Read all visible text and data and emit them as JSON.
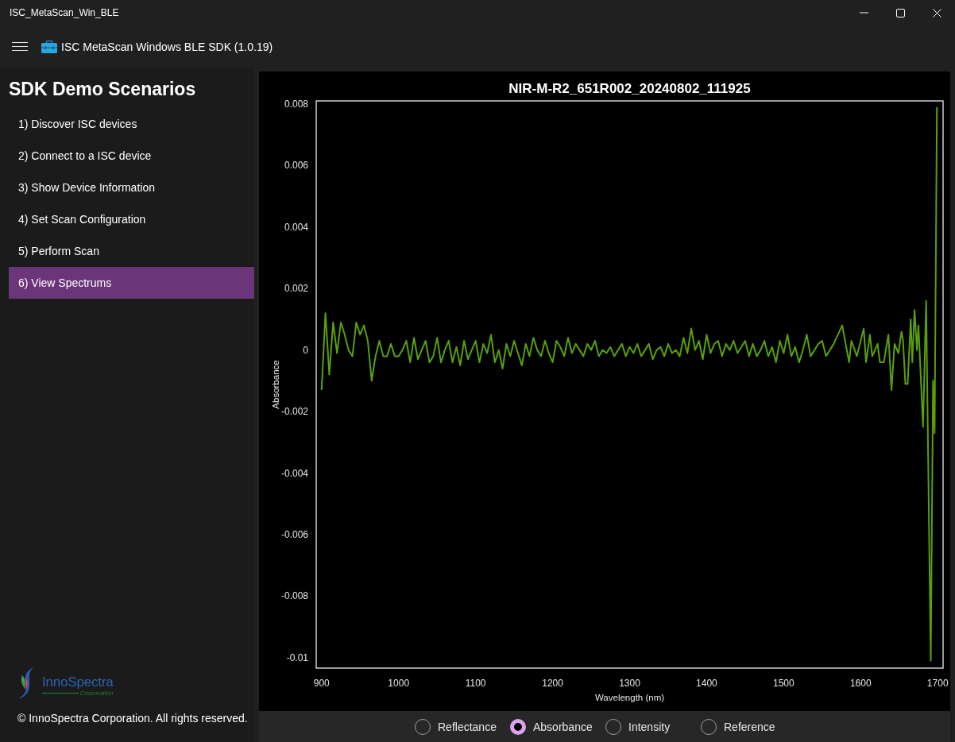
{
  "window": {
    "title": "ISC_MetaScan_Win_BLE"
  },
  "header": {
    "title": "ISC MetaScan Windows BLE SDK (1.0.19)"
  },
  "sidebar": {
    "title": "SDK Demo Scenarios",
    "items": [
      {
        "label": "1) Discover ISC devices",
        "selected": false
      },
      {
        "label": "2) Connect to a ISC device",
        "selected": false
      },
      {
        "label": "3) Show Device Information",
        "selected": false
      },
      {
        "label": "4) Set Scan Configuration",
        "selected": false
      },
      {
        "label": "5) Perform Scan",
        "selected": false
      },
      {
        "label": "6) View Spectrums",
        "selected": true
      }
    ],
    "logo": {
      "name": "InnoSpectra",
      "tagline": "Corporation"
    },
    "copyright": "© InnoSpectra Corporation. All rights reserved."
  },
  "chart": {
    "chart_data": {
      "type": "line",
      "title": "NIR-M-R2_651R002_20240802_111925",
      "xlabel": "Wavelength (nm)",
      "ylabel": "Absorbance",
      "x": [
        900,
        905,
        910,
        915,
        920,
        925,
        930,
        935,
        940,
        945,
        950,
        955,
        960,
        965,
        970,
        975,
        980,
        985,
        990,
        995,
        1000,
        1005,
        1010,
        1015,
        1020,
        1025,
        1030,
        1035,
        1040,
        1045,
        1050,
        1055,
        1060,
        1065,
        1070,
        1075,
        1080,
        1085,
        1090,
        1095,
        1100,
        1105,
        1110,
        1115,
        1120,
        1125,
        1130,
        1135,
        1140,
        1145,
        1150,
        1155,
        1160,
        1165,
        1170,
        1175,
        1180,
        1185,
        1190,
        1195,
        1200,
        1205,
        1210,
        1215,
        1220,
        1225,
        1230,
        1235,
        1240,
        1245,
        1250,
        1255,
        1260,
        1265,
        1270,
        1275,
        1280,
        1285,
        1290,
        1295,
        1300,
        1305,
        1310,
        1315,
        1320,
        1325,
        1330,
        1335,
        1340,
        1345,
        1350,
        1355,
        1360,
        1365,
        1370,
        1375,
        1380,
        1385,
        1390,
        1395,
        1400,
        1405,
        1410,
        1415,
        1420,
        1425,
        1430,
        1435,
        1440,
        1445,
        1450,
        1455,
        1460,
        1465,
        1470,
        1475,
        1480,
        1485,
        1490,
        1495,
        1500,
        1505,
        1510,
        1515,
        1520,
        1525,
        1530,
        1535,
        1540,
        1545,
        1550,
        1555,
        1565,
        1576,
        1585,
        1588,
        1595,
        1604,
        1607,
        1612,
        1615,
        1622,
        1625,
        1630,
        1636,
        1640,
        1644,
        1649,
        1653,
        1655,
        1658,
        1661,
        1665,
        1667,
        1670,
        1673,
        1675,
        1681,
        1685,
        1691,
        1694,
        1696,
        1699
      ],
      "series": [
        {
          "color": "#58a00c",
          "values": [
            -0.0013,
            0.0012,
            -0.0008,
            0.0009,
            -0.0001,
            0.0009,
            0.0005,
            0,
            -0.0002,
            0.0009,
            0.0005,
            0.0008,
            0.0003,
            -0.001,
            -0.0002,
            0.0003,
            -0.0002,
            -0.0002,
            0.0002,
            -0.0002,
            -0.0002,
            0,
            0.0003,
            -0.0004,
            0.0004,
            -0.0003,
            0,
            0.0003,
            -0.0004,
            -0.0002,
            0.0004,
            -0.0004,
            0,
            0.0003,
            -0.0004,
            0.0001,
            -0.0005,
            0.0003,
            -0.0003,
            0,
            0.0003,
            -0.0004,
            0.0002,
            -0.0001,
            0.0005,
            -0.0004,
            0,
            -0.0006,
            0.0002,
            -0.0002,
            0.0003,
            -0.0001,
            -0.0005,
            0.0002,
            -0.0002,
            0.0004,
            0,
            -0.0002,
            0.0003,
            -0.0001,
            -0.0004,
            0.0003,
            0.0001,
            -0.0002,
            0.0004,
            -0.0001,
            0.0002,
            0,
            -0.0002,
            0.0002,
            0,
            0.0003,
            -0.0002,
            0,
            -0.0001,
            0.0001,
            -0.0002,
            0,
            0.0002,
            -0.0002,
            0.0001,
            -0.0001,
            0.0002,
            -0.0002,
            0,
            0.0002,
            -0.0003,
            0,
            0.0001,
            -0.0002,
            0.0002,
            -0.0001,
            0,
            -0.0002,
            0.0004,
            -0.0001,
            0.0007,
            0,
            0.0003,
            -0.0003,
            0.0005,
            -0.0001,
            0.0002,
            0.0003,
            -0.0002,
            0.0002,
            0,
            0.0003,
            -0.0001,
            0.0001,
            0.0003,
            -0.0002,
            0.0002,
            -0.0002,
            0,
            0.0003,
            -0.0002,
            0.0001,
            -0.0004,
            0.0003,
            -0.0001,
            0.0005,
            -0.0002,
            0.0001,
            -0.0004,
            0,
            0.0005,
            -0.0002,
            0,
            0.0002,
            0.0003,
            -0.0002,
            0.0002,
            0.0008,
            -0.0004,
            0.0003,
            -0.0002,
            0.0007,
            -0.0004,
            0.0005,
            -0.0002,
            0.0002,
            -0.0004,
            -0.0004,
            0.0005,
            -0.0013,
            0.0002,
            -0.0001,
            0.0006,
            0.0003,
            -0.0011,
            -0.0011,
            0.001,
            -0.0004,
            0.0013,
            0,
            0.0008,
            -0.0025,
            0.0016,
            -0.0101,
            -0.001,
            -0.0027,
            0.0079
          ]
        }
      ],
      "xlim": [
        893,
        1707
      ],
      "ylim": [
        -0.01034,
        0.0081
      ],
      "xticks": [
        900,
        1000,
        1100,
        1200,
        1300,
        1400,
        1500,
        1600,
        1700
      ],
      "yticks": [
        0.008,
        0.006,
        0.004,
        0.002,
        0,
        -0.002,
        -0.004,
        -0.006,
        -0.008,
        -0.01
      ]
    }
  },
  "view_modes": [
    {
      "label": "Reflectance",
      "selected": false
    },
    {
      "label": "Absorbance",
      "selected": true
    },
    {
      "label": "Intensity",
      "selected": false
    },
    {
      "label": "Reference",
      "selected": false
    }
  ]
}
